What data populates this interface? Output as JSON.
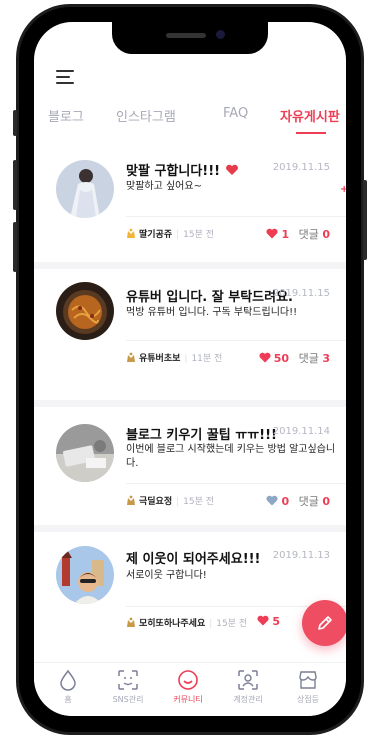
{
  "tabs": [
    {
      "label": "블로그",
      "active": false
    },
    {
      "label": "인스타그램",
      "active": false
    },
    {
      "label": "FAQ",
      "active": false
    },
    {
      "label": "자유게시판",
      "active": true,
      "badge": "+"
    }
  ],
  "posts": [
    {
      "title": "맞팔 구합니다!!!",
      "title_emoji": "heart-icon",
      "date": "2019.11.15",
      "body": "맞팔하고 싶어요~",
      "author": "딸기공쥬",
      "ago": "15분 전",
      "likes": "1",
      "comments": "0",
      "comment_label": "댓글",
      "liked": true
    },
    {
      "title": "유튜버 입니다. 잘 부탁드려요.",
      "date": "2019.11.15",
      "body": "먹방 유튜버 입니다. 구독 부탁드립니다!!",
      "author": "유튜버초보",
      "ago": "11분 전",
      "likes": "50",
      "comments": "3",
      "comment_label": "댓글",
      "liked": true
    },
    {
      "title": "블로그 키우기 꿀팁 ㅠㅠ!!!",
      "date": "2019.11.14",
      "body": "이번에 블로그 시작했는데 키우는 방법 알고싶습니다.",
      "author": "극딜요정",
      "ago": "15분 전",
      "likes": "0",
      "comments": "0",
      "comment_label": "댓글",
      "liked": false
    },
    {
      "title": "제 이웃이 되어주세요!!!",
      "date": "2019.11.13",
      "body": "서로이웃 구합니다!",
      "author": "모히또하나주세요",
      "ago": "15분 전",
      "likes": "5",
      "comments": "",
      "comment_label": "",
      "liked": true
    }
  ],
  "nav": [
    {
      "label": "홈",
      "icon": "drop-icon",
      "active": false
    },
    {
      "label": "SNS관리",
      "icon": "scan-icon",
      "active": false
    },
    {
      "label": "커뮤니티",
      "icon": "smile-icon",
      "active": true
    },
    {
      "label": "계정관리",
      "icon": "account-icon",
      "active": false
    },
    {
      "label": "상점등",
      "icon": "store-icon",
      "active": false
    }
  ],
  "colors": {
    "accent": "#ef3d55",
    "muted": "#a7a9b7",
    "like_grey": "#8fa6c4"
  }
}
